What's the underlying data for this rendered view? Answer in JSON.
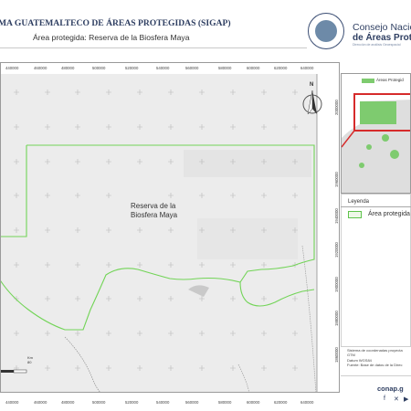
{
  "header": {
    "title": "MA GUATEMALTECO DE ÁREAS PROTEGIDAS  (SIGAP)",
    "subtitle": "Área protegida: Reserva de la Biosfera Maya"
  },
  "logo": {
    "line1": "Consejo Nacional",
    "line2": "de Áreas Protegi",
    "line3": "Dirección de análisis Geoespacial"
  },
  "map": {
    "area_label_line1": "Reserva de la",
    "area_label_line2": "Biosfera Maya",
    "north_label": "N",
    "x_ticks": [
      "440000",
      "460000",
      "480000",
      "500000",
      "520000",
      "540000",
      "560000",
      "580000",
      "600000",
      "620000",
      "640000"
    ],
    "y_ticks_right": [
      "2000000",
      "1980000",
      "1960000",
      "1940000",
      "1920000",
      "1900000",
      "1880000",
      "1860000",
      "1840000",
      "1820000"
    ],
    "scale_key_label": "Km",
    "scale_value": "80",
    "colors": {
      "background": "#ececec",
      "boundary": "#72d457",
      "grid": "#b8b8b8"
    }
  },
  "inset": {
    "legend_label": "Áreas Protegid",
    "colors": {
      "frame": "#d62b2b",
      "land": "#dedede",
      "protected": "#7ecb6f",
      "water": "#ffffff"
    }
  },
  "legend": {
    "title": "Leyenda",
    "item_label": "Área protegida",
    "swatch_color": "#eef8e8"
  },
  "info": {
    "lines": [
      "Sistema de coordenadas proyecta",
      "GTM",
      "Datum WGS84",
      "Fuente: Base de datos de la Direc"
    ]
  },
  "footer": {
    "url": "conap.g",
    "social_icons": [
      "facebook-icon",
      "x-icon",
      "youtube-icon"
    ]
  }
}
